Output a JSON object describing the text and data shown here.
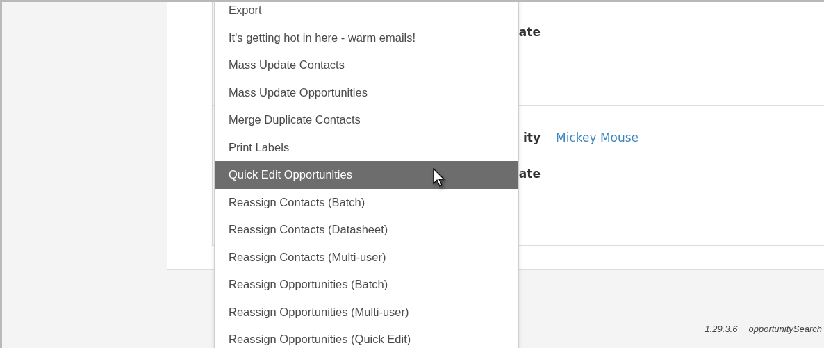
{
  "form": {
    "sections": [
      {
        "rows": [
          {
            "label": "ate"
          }
        ]
      },
      {
        "rows": [
          {
            "label": "ity",
            "value": "Mickey Mouse"
          },
          {
            "label": "ate"
          }
        ]
      }
    ]
  },
  "menu": {
    "items": [
      {
        "label": "Export",
        "selected": false
      },
      {
        "label": "It's getting hot in here - warm emails!",
        "selected": false
      },
      {
        "label": "Mass Update Contacts",
        "selected": false
      },
      {
        "label": "Mass Update Opportunities",
        "selected": false
      },
      {
        "label": "Merge Duplicate Contacts",
        "selected": false
      },
      {
        "label": "Print Labels",
        "selected": false
      },
      {
        "label": "Quick Edit Opportunities",
        "selected": true
      },
      {
        "label": "Reassign Contacts (Batch)",
        "selected": false
      },
      {
        "label": "Reassign Contacts (Datasheet)",
        "selected": false
      },
      {
        "label": "Reassign Contacts (Multi-user)",
        "selected": false
      },
      {
        "label": "Reassign Opportunities (Batch)",
        "selected": false
      },
      {
        "label": "Reassign Opportunities (Multi-user)",
        "selected": false
      },
      {
        "label": "Reassign Opportunities (Quick Edit)",
        "selected": false
      }
    ]
  },
  "footer": {
    "version": "1.29.3.6",
    "page": "opportunitySearch"
  }
}
